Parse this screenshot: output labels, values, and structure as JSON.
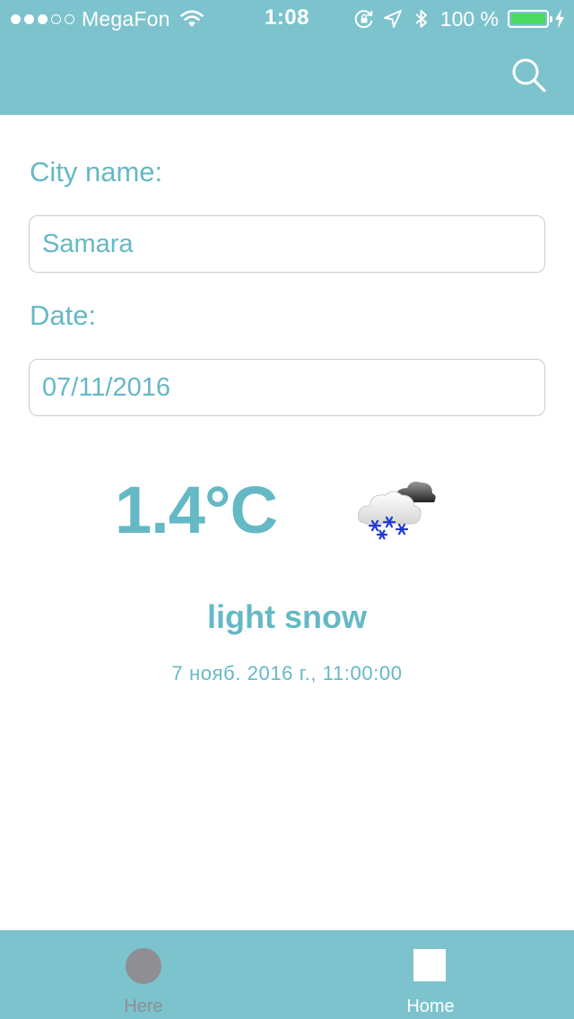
{
  "status_bar": {
    "signal_dots_filled": 3,
    "signal_dots_total": 5,
    "carrier": "MegaFon",
    "time": "1:08",
    "battery_percent": "100 %",
    "battery_level": 1.0,
    "icons": [
      "wifi-icon",
      "rotation-lock-icon",
      "location-arrow-icon",
      "bluetooth-icon",
      "battery-icon",
      "charging-bolt-icon"
    ]
  },
  "nav_bar": {
    "search_icon": "search-icon",
    "color": "#7cc3cd"
  },
  "form": {
    "city_label": "City name:",
    "city_value": "Samara",
    "date_label": "Date:",
    "date_value": "07/11/2016"
  },
  "weather": {
    "temperature": "1.4°C",
    "icon": "light-snow-cloud-icon",
    "description": "light snow",
    "timestamp": "7 нояб. 2016 г., 11:00:00"
  },
  "tab_bar": {
    "tabs": [
      {
        "label": "Here",
        "icon": "circle-icon",
        "selected": false
      },
      {
        "label": "Home",
        "icon": "square-icon",
        "selected": true
      }
    ]
  },
  "colors": {
    "accent": "#7cc3cd",
    "text": "#64b9c5",
    "inactive_tab": "#8e8e93",
    "battery_fill": "#4cd964"
  }
}
